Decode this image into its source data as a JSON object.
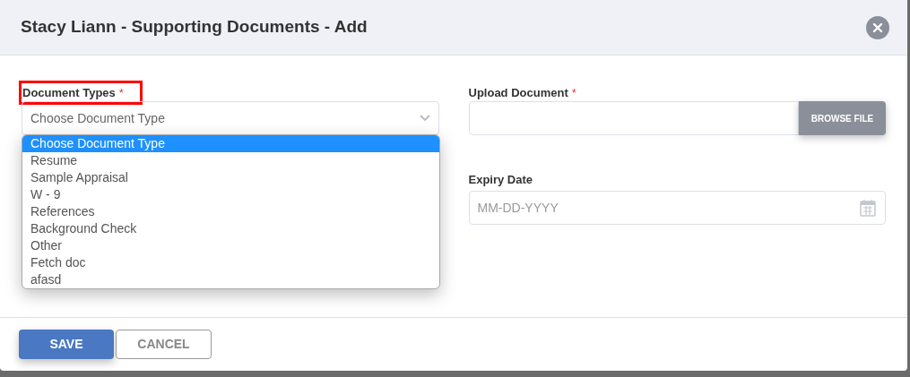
{
  "dialog": {
    "title": "Stacy Liann - Supporting Documents - Add"
  },
  "document_types": {
    "label": "Document Types",
    "required_mark": "*",
    "highlighted": true,
    "placeholder": "Choose Document Type",
    "expanded": true,
    "options": [
      {
        "label": "Choose Document Type",
        "selected": true
      },
      {
        "label": "Resume",
        "selected": false
      },
      {
        "label": "Sample Appraisal",
        "selected": false
      },
      {
        "label": "W - 9",
        "selected": false
      },
      {
        "label": "References",
        "selected": false
      },
      {
        "label": "Background Check",
        "selected": false
      },
      {
        "label": "Other",
        "selected": false
      },
      {
        "label": "Fetch doc",
        "selected": false
      },
      {
        "label": "afasd",
        "selected": false
      }
    ]
  },
  "upload_document": {
    "label": "Upload Document",
    "required_mark": "*",
    "button": "BROWSE FILE"
  },
  "expiry_date": {
    "label": "Expiry Date",
    "placeholder": "MM-DD-YYYY"
  },
  "buttons": [
    {
      "label": "SAVE",
      "kind": "primary"
    },
    {
      "label": "CANCEL",
      "kind": "secondary"
    }
  ]
}
